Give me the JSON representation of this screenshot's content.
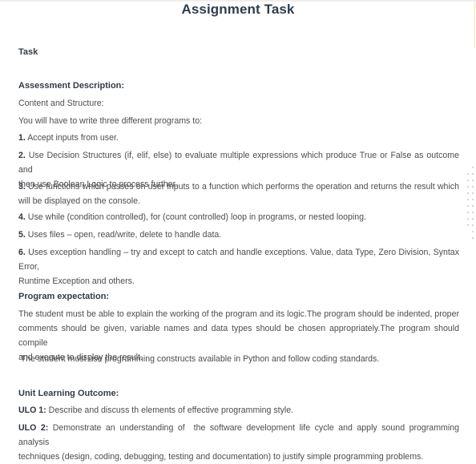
{
  "page": {
    "title": "Assignment Task",
    "task_label": "Task"
  },
  "assessment": {
    "heading": "Assessment Description:",
    "content_structure": "Content and Structure:",
    "intro": "You will have to write three different programs to:",
    "items": [
      {
        "num": "1.",
        "text": " Accept inputs from user."
      },
      {
        "num": "2.",
        "line1": " Use Decision Structures (if, elif, else) to evaluate multiple expressions which produce True or False as outcome and",
        "line2": "then use Boolean Logic to process further."
      },
      {
        "num": "3.",
        "line1": " Use functions which passes on user inputs to a function which performs the operation and returns the result which",
        "line2": "will be displayed on the console."
      },
      {
        "num": "4.",
        "text": " Use while (condition controlled), for (count controlled) loop in programs, or nested looping."
      },
      {
        "num": "5.",
        "text": " Uses files – open, read/write, delete to handle data."
      },
      {
        "num": "6.",
        "line1": " Uses exception handling – try and except to catch and handle exceptions. Value, data Type, Zero Division, Syntax Error,",
        "line2": "Runtime Exception and others."
      }
    ]
  },
  "program_expectation": {
    "heading": "Program expectation:",
    "para1_line1": "The student must be able to explain the working of the program and its logic.The program should be indented, proper",
    "para1_line2": "comments should be given, variable names and data types should be chosen appropriately.The program should compile",
    "para1_line3": "and execute to display the result.",
    "para2": " The student must use programming constructs available in Python and follow coding standards."
  },
  "ulo": {
    "heading": "Unit Learning Outcome:",
    "items": [
      {
        "label": "ULO 1:",
        "text": " Describe and discuss th elements of effective programming style."
      },
      {
        "label": "ULO 2:",
        "line1": " Demonstrate an understanding of  the software development life cycle and apply sound programming analysis",
        "line2": "techniques (design, coding, debugging, testing and documentation) to justify simple programming problems."
      }
    ]
  }
}
